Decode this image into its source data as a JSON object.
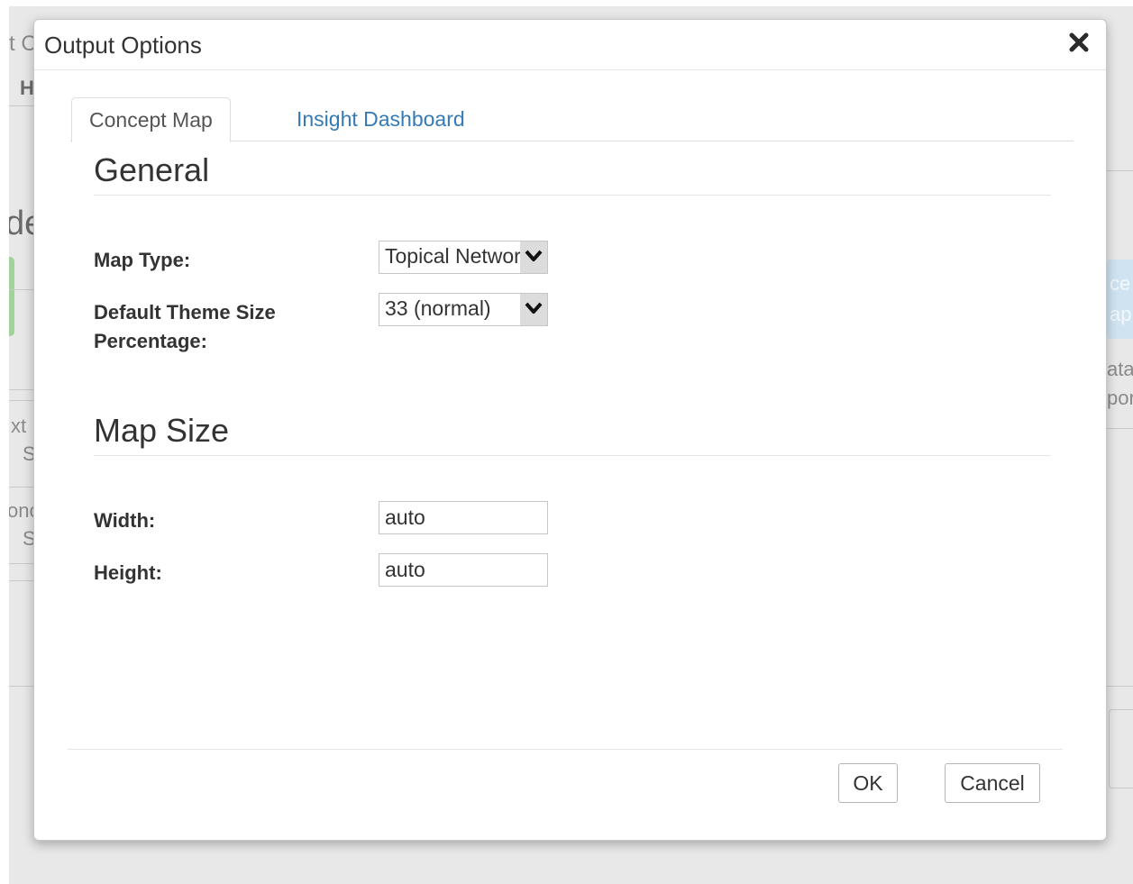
{
  "background": {
    "text_1": "t C",
    "text_2": "H",
    "text_3": "de",
    "text_4": "xt",
    "text_5": "S",
    "text_6": "onc",
    "text_7": "S",
    "text_8": "ce",
    "text_9": "ap",
    "text_10": "ata",
    "text_11": "por"
  },
  "modal": {
    "title": "Output Options",
    "close_icon": "close-icon",
    "tabs": [
      {
        "label": "Concept Map",
        "active": true
      },
      {
        "label": "Insight Dashboard",
        "active": false
      }
    ],
    "general": {
      "heading": "General",
      "map_type_label": "Map Type:",
      "map_type_value": "Topical Network",
      "theme_size_label_line1": "Default Theme Size",
      "theme_size_label_line2": "Percentage:",
      "theme_size_value": "33 (normal)"
    },
    "map_size": {
      "heading": "Map Size",
      "width_label": "Width:",
      "width_value": "auto",
      "height_label": "Height:",
      "height_value": "auto"
    },
    "buttons": {
      "ok": "OK",
      "cancel": "Cancel"
    }
  },
  "colors": {
    "link": "#337ab7",
    "backdrop": "#e8e8e8"
  }
}
